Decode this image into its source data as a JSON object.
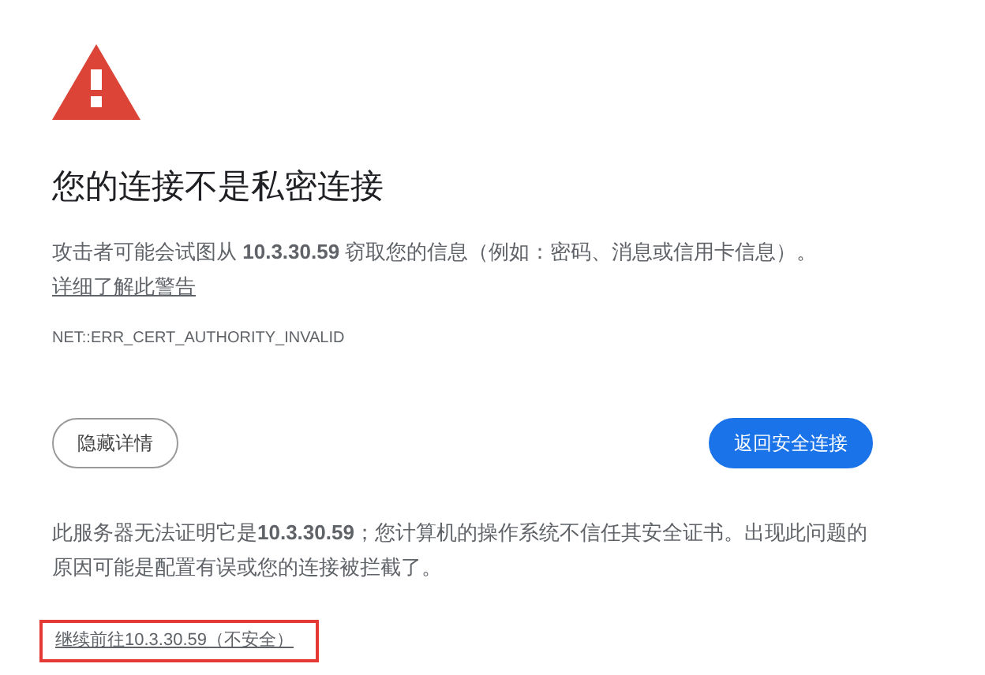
{
  "heading": "您的连接不是私密连接",
  "intro": {
    "text": "攻击者可能会试图从 **10.3.30.59** 窃取您的信息（例如：密码、消息或信用卡信息）。",
    "link": "详细了解此警告"
  },
  "error_code": "NET::ERR_CERT_AUTHORITY_INVALID",
  "buttons": [
    {
      "label": "隐藏详情",
      "kind": "outline"
    },
    {
      "label": "返回安全连接",
      "kind": "primary"
    }
  ],
  "details": "此服务器无法证明它是**10.3.30.59**；您计算机的操作系统不信任其安全证书。出现此问题的原因可能是配置有误或您的连接被拦截了。",
  "proceed_link": {
    "text": "继续前往10.3.30.59（不安全）",
    "highlighted": true
  }
}
